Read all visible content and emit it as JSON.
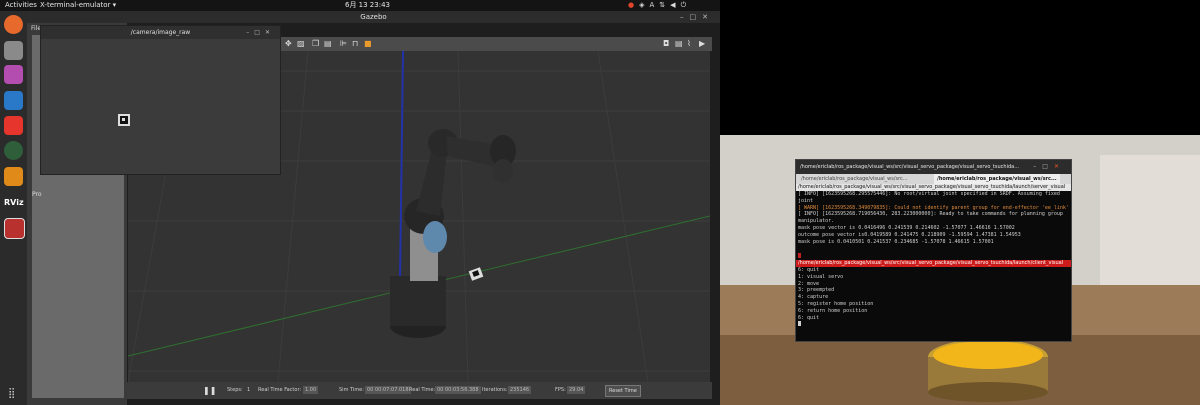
{
  "topbar": {
    "activities": "Activities",
    "app_menu": "X-terminal-emulator",
    "clock": "6月 13  23:43",
    "input_method": "A"
  },
  "dock": {
    "items": [
      {
        "name": "firefox-icon",
        "glyph": "",
        "color": "#e8692c"
      },
      {
        "name": "files-icon",
        "glyph": "",
        "color": "#8a8a8a"
      },
      {
        "name": "screenshot-icon",
        "glyph": "",
        "color": "#b44db0"
      },
      {
        "name": "vscode-icon",
        "glyph": "",
        "color": "#2a78c8"
      },
      {
        "name": "anydesk-icon",
        "glyph": "",
        "color": "#e5352c"
      },
      {
        "name": "gazebo-icon",
        "glyph": "",
        "color": "#c87a20"
      },
      {
        "name": "layers-icon",
        "glyph": "",
        "color": "#e08a1a"
      },
      {
        "name": "rviz-icon",
        "glyph": "RViz",
        "color": "#3a3a3a"
      },
      {
        "name": "terminal-icon",
        "glyph": "",
        "color": "#b8312f"
      }
    ]
  },
  "gazebo": {
    "title": "Gazebo",
    "menu_file": "File",
    "panel_label": "Pro",
    "bottom": {
      "steps_label": "Steps:",
      "steps_value": "1",
      "rtf_label": "Real Time Factor:",
      "rtf_value": "1.00",
      "sim_label": "Sim Time:",
      "sim_value": "00 00:07:07.018",
      "real_label": "Real Time:",
      "real_value": "00 00:03:56.388",
      "iter_label": "Iterations:",
      "iter_value": "235146",
      "fps_label": "FPS:",
      "fps_value": "29.04",
      "reset": "Reset Time"
    }
  },
  "camera_window": {
    "title": "/camera/image_raw"
  },
  "terminal": {
    "title": "/home/ericlab/ros_package/visual_ws/src/visual_servo_package/visual_servo_tsuchida...",
    "tabs": [
      "/home/ericlab/ros_package/visual_ws/src...",
      "/home/ericlab/ros_package/visual_ws/src..."
    ],
    "pane1_title": "/home/ericlab/ros_package/visual_ws/src/visual_servo_package/visual_servo_tsuchida/launch/server_visual",
    "pane1_lines": [
      "[ INFO] [1623595268.295575446]: No root/virtual joint specified in SRDF. Assuming fixed joint",
      "[ WARN] [1623595268.349079835]: Could not identify parent group for end-effector 'ee_link'",
      "[ INFO] [1623595268.719056430, 283.223000000]: Ready to take commands for planning group manipulator.",
      "mask pose vector is 0.0416496 0.241539 0.214602 -1.57077 1.46616 1.57002",
      "outcome pose vector is0.0419589 0.241475 0.218909 -1.59594 1.47381 1.54953",
      "mask pose is 0.0410501 0.241537 0.234685 -1.57078 1.46615 1.57001"
    ],
    "pane2_title": "/home/ericlab/ros_package/visual_ws/src/visual_servo_package/visual_servo_tsuchida/launch/client_visual",
    "pane2_lines": [
      "6: quit",
      "",
      "1: visual servo",
      "2: move",
      "3: preempted",
      "4: capture",
      "5: register home position",
      "6: return home position",
      "6: quit"
    ]
  }
}
